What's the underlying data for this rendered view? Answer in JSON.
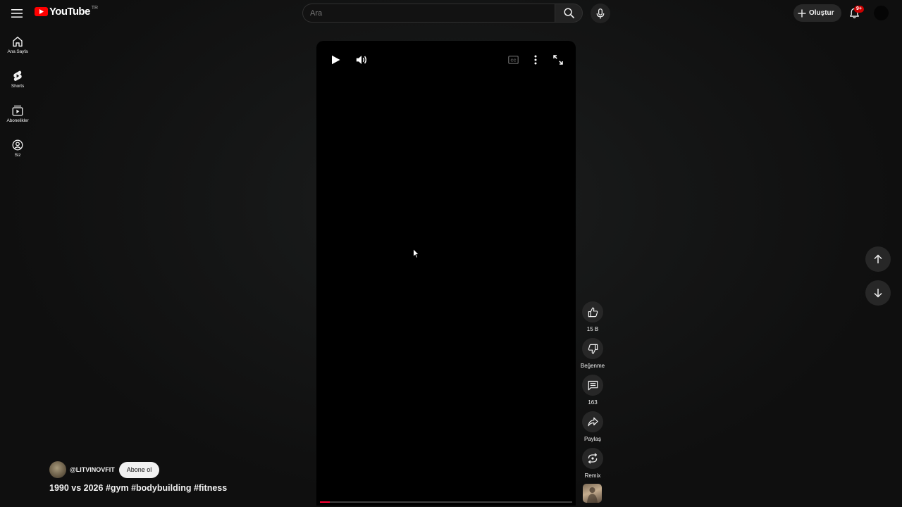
{
  "header": {
    "logo_text": "YouTube",
    "country_code": "TR",
    "search_placeholder": "Ara",
    "create_label": "Oluştur",
    "notification_badge": "9+"
  },
  "sidebar": {
    "items": [
      {
        "label": "Ana Sayfa",
        "icon": "home-icon"
      },
      {
        "label": "Shorts",
        "icon": "shorts-icon"
      },
      {
        "label": "Abonelikler",
        "icon": "subscriptions-icon"
      },
      {
        "label": "Siz",
        "icon": "you-icon"
      }
    ]
  },
  "player": {
    "progress_percent": 4
  },
  "actions": {
    "like_count": "15 B",
    "dislike_label": "Beğenme",
    "comment_count": "163",
    "share_label": "Paylaş",
    "remix_label": "Remix"
  },
  "video": {
    "channel_handle": "@LITVINOVFIT",
    "subscribe_label": "Abone ol",
    "title": "1990 vs 2026 #gym #bodybuilding #fitness"
  },
  "colors": {
    "background": "#0f0f0f",
    "accent_red": "#ff0000",
    "progress_red": "#ff0033",
    "button_bg": "#272727"
  }
}
